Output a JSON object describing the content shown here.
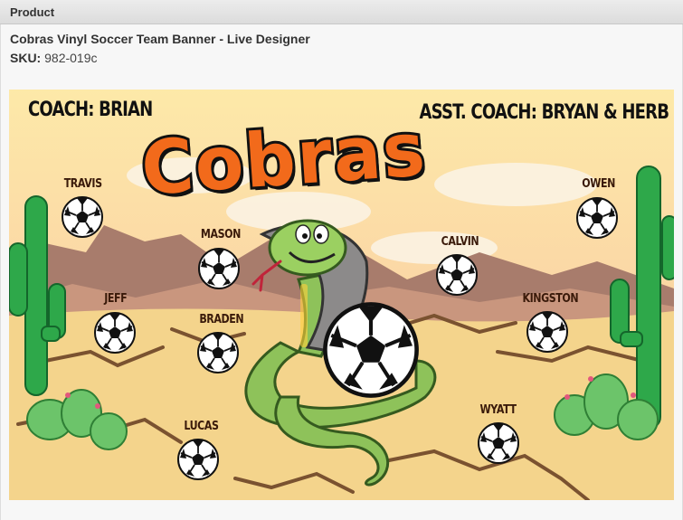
{
  "panel": {
    "header_label": "Product"
  },
  "product": {
    "title": "Cobras Vinyl Soccer Team Banner - Live Designer",
    "sku_label": "SKU:",
    "sku_value": "982-019c"
  },
  "banner": {
    "team_name": "Cobras",
    "coach": "COACH: BRIAN",
    "assistant_coach": "ASST. COACH: BRYAN & HERB",
    "players": [
      "TRAVIS",
      "MASON",
      "JEFF",
      "BRADEN",
      "LUCAS",
      "CALVIN",
      "KINGSTON",
      "WYATT",
      "OWEN"
    ],
    "colors": {
      "sky": "#fde49a",
      "sand": "#f6d98c",
      "cactus": "#2ea84a",
      "team_name": "#f26a1b",
      "snake": "#8ec25a"
    }
  }
}
